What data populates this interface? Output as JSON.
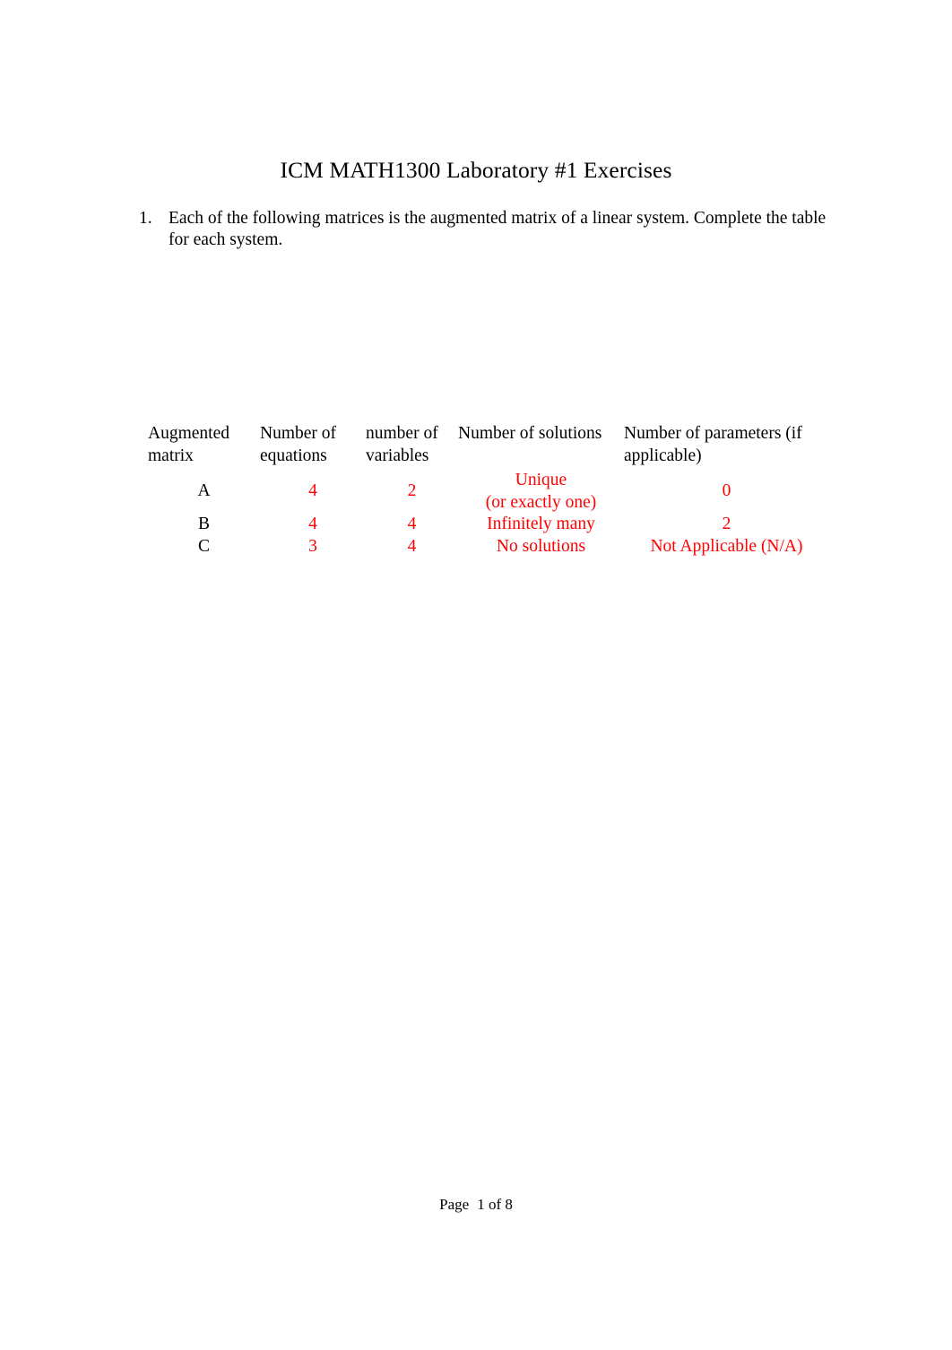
{
  "document": {
    "title": "ICM MATH1300 Laboratory #1 Exercises",
    "accent_color": "#FF0000",
    "text_color": "#000000",
    "background_color": "#FFFFFF"
  },
  "exercise": {
    "number": "1.",
    "text": "Each of the following matrices is the augmented matrix of a linear system. Complete the table for each system."
  },
  "table": {
    "headers": {
      "matrix": "Augmented matrix",
      "equations": "Number of equations",
      "variables": "number of variables",
      "solutions": "Number of solutions",
      "parameters": "Number of parameters (if applicable)"
    },
    "rows": [
      {
        "matrix": "A",
        "equations": "4",
        "variables": "2",
        "solutions_line1": "Unique",
        "solutions_line2": "(or exactly one)",
        "parameters": "0"
      },
      {
        "matrix": "B",
        "equations": "4",
        "variables": "4",
        "solutions_line1": "Infinitely many",
        "solutions_line2": "",
        "parameters": "2"
      },
      {
        "matrix": "C",
        "equations": "3",
        "variables": "4",
        "solutions_line1": "No solutions",
        "solutions_line2": "",
        "parameters": "Not Applicable (N/A)"
      }
    ]
  },
  "footer": {
    "page_word": "Page",
    "page_number": "1 of 8"
  }
}
